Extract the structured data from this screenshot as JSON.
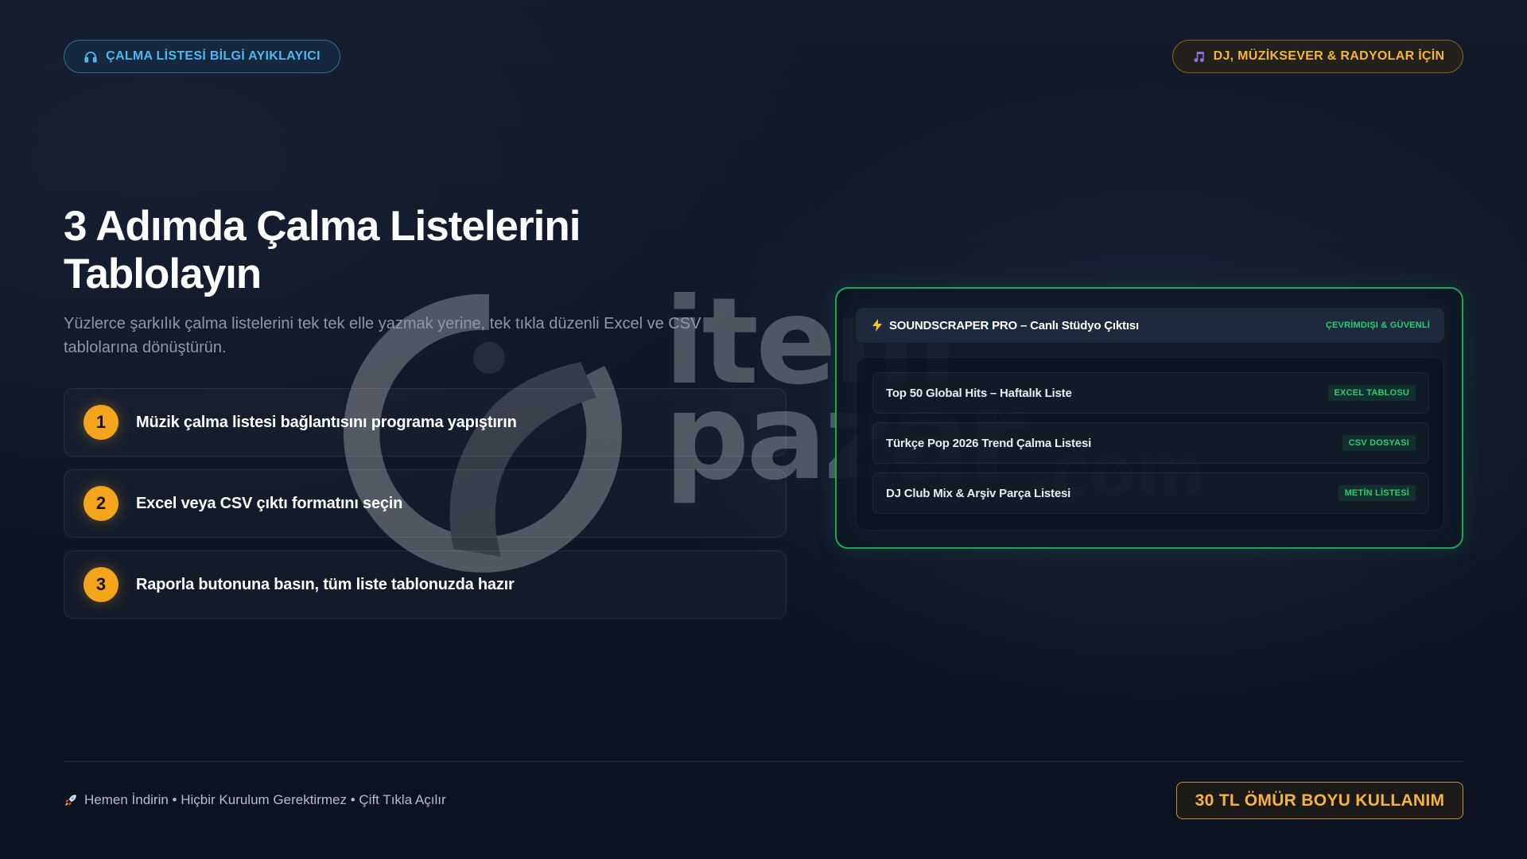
{
  "badges": {
    "left": "ÇALMA LİSTESİ BİLGİ AYIKLAYICI",
    "right": "DJ, MÜZİKSEVER & RADYOLAR İÇİN"
  },
  "hero": {
    "title_line1": "3 Adımda Çalma Listelerini",
    "title_line2": "Tablolayın",
    "subtitle": "Yüzlerce şarkılık çalma listelerini tek tek elle yazmak yerine, tek tıkla düzenli Excel ve CSV tablolarına dönüştürün."
  },
  "steps": [
    {
      "number": "1",
      "text": "Müzik çalma listesi bağlantısını programa yapıştırın"
    },
    {
      "number": "2",
      "text": "Excel veya CSV çıktı formatını seçin"
    },
    {
      "number": "3",
      "text": "Raporla butonuna basın, tüm liste tablonuzda hazır"
    }
  ],
  "studio": {
    "title": "SOUNDSCRAPER PRO – Canlı Stüdyo Çıktısı",
    "badge": "ÇEVRİMDIŞI & GÜVENLİ",
    "rows": [
      {
        "name": "Top 50 Global Hits – Haftalık Liste",
        "tag": "EXCEL TABLOSU"
      },
      {
        "name": "Türkçe Pop 2026 Trend Çalma Listesi",
        "tag": "CSV DOSYASI"
      },
      {
        "name": "DJ Club Mix & Arşiv Parça Listesi",
        "tag": "METİN LİSTESİ"
      }
    ]
  },
  "footer": {
    "note": "Hemen İndirin • Hiçbir Kurulum Gerektirmez • Çift Tıkla Açılır",
    "price": "30 TL ÖMÜR BOYU KULLANIM"
  },
  "watermark": {
    "line1": "item",
    "line2": "pazar",
    "suffix": ".com"
  },
  "icons": {
    "left_badge": "headphones-icon",
    "right_badge": "music-note-icon",
    "studio": "lightning-icon",
    "footer": "rocket-icon"
  },
  "colors": {
    "accent_blue": "#4fb6ee",
    "accent_gold": "#f2b43a",
    "step_number": "#f4a51c",
    "success_green": "#2ecc71",
    "panel_border": "#22a455"
  }
}
